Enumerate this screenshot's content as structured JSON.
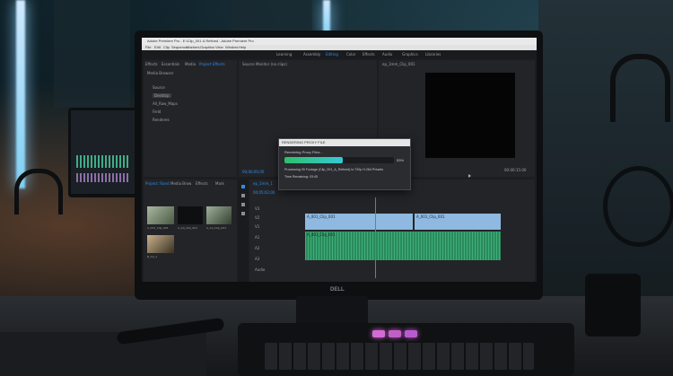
{
  "window": {
    "title": "Adobe Premiere Pro - E:\\Clip_001 & Refined - Adobe Premiere Pro",
    "menu": [
      "File",
      "Edit",
      "Clip",
      "Sequence",
      "Markers",
      "Graphics",
      "View",
      "Window",
      "Help"
    ]
  },
  "workspaces": [
    "Learning",
    "Assembly",
    "Editing",
    "Color",
    "Effects",
    "Audio",
    "Graphics",
    "Libraries"
  ],
  "workspace_active": "Editing",
  "project_panel": {
    "tabs": [
      "Effects",
      "Essentials",
      "Media",
      "Project Effects"
    ],
    "search_placeholder": "Media Browser",
    "tree": [
      "Source",
      "Desktop",
      "All_Raw_Maps",
      "Field",
      "Renderes"
    ]
  },
  "source_panel": {
    "tab": "Source Monitor (no clips)",
    "timecode": "00;00;00;00"
  },
  "program_panel": {
    "tab": "ep_1mm_Clip_001",
    "timecode": "00;05;05;00",
    "duration": "00:00:15:00"
  },
  "render_dialog": {
    "title": "RENDERING PROXY FILE",
    "status": "Rendering Proxy Files...",
    "percent": "53%",
    "progress": 0.53,
    "detail": "Processing 05 Footage (Clip_001_A_Refined) to 720p H.264 Presets",
    "time_remaining": "Time Remaining: 03:45"
  },
  "bin_panel": {
    "tabs": [
      "Project: Rand",
      "Media Brow",
      "Effects",
      "Mark"
    ],
    "clips": [
      "A_001_Clip_001",
      "A_AA_Clip_001",
      "A_AA_Clip_001",
      "B_AA_1"
    ]
  },
  "timeline": {
    "tab": "ep_1mm_1",
    "timecode": "00;05;02;00",
    "video_clips": [
      "A_001_Clip_001",
      "A_001_Clip_001"
    ],
    "audio_clips": [
      "A_001_Clip_001"
    ],
    "tracks": [
      "V3",
      "V2",
      "V1",
      "A1",
      "A2",
      "A3"
    ],
    "master": "Audio"
  },
  "monitor_brand": "DELL",
  "colors": {
    "accent": "#2d8ceb",
    "progress": "#2fbf6a",
    "video_clip": "#8fb9e0",
    "audio_clip": "#3fae7a"
  }
}
